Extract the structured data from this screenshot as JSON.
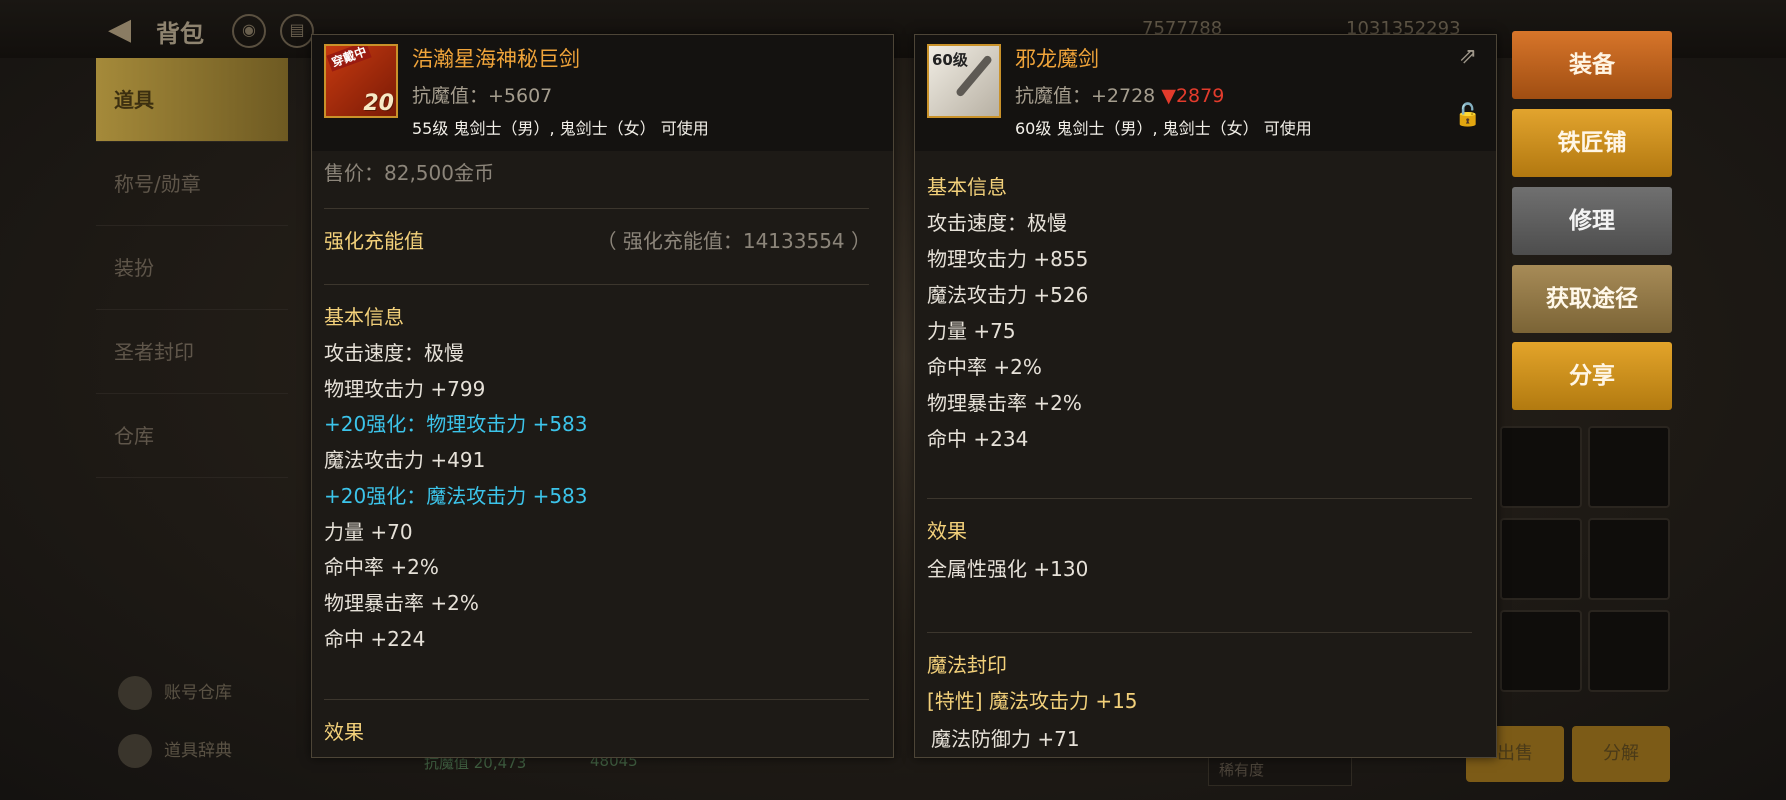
{
  "background": {
    "title": "背包",
    "currency_1": "7577788",
    "currency_2": "1031352293",
    "menu": [
      "道具",
      "称号/勋章",
      "装扮",
      "圣者封印",
      "仓库"
    ],
    "menu_bottom": [
      "账号仓库",
      "道具辞典"
    ],
    "bottom_buttons": [
      "出售",
      "分解"
    ],
    "sort_label": "稀有度",
    "stat_left": "抗魔值 20,473",
    "stat_right": "48045"
  },
  "left_item": {
    "thumb_badge": "穿戴中",
    "thumb_level": "20",
    "name": "浩瀚星海神秘巨剑",
    "resist": "抗魔值：+5607",
    "usable": "55级 鬼剑士（男）, 鬼剑士（女） 可使用",
    "price": "售价：82,500金币",
    "charge_label": "强化充能值",
    "charge_value": "（ 强化充能值：14133554 ）",
    "basic_info_title": "基本信息",
    "attack_speed": "攻击速度：极慢",
    "phys_attack": "物理攻击力 +799",
    "phys_reinforce": "+20强化：物理攻击力 +583",
    "magic_attack": "魔法攻击力 +491",
    "magic_reinforce": "+20强化：魔法攻击力 +583",
    "strength": "力量 +70",
    "hit_rate": "命中率 +2%",
    "phys_crit": "物理暴击率 +2%",
    "hit": "命中 +224",
    "effect_title": "效果"
  },
  "right_item": {
    "thumb_level": "60级",
    "name": "邪龙魔剑",
    "resist_label": "抗魔值：+2728",
    "resist_diff": "▼2879",
    "usable": "60级 鬼剑士（男）, 鬼剑士（女） 可使用",
    "basic_info_title": "基本信息",
    "attack_speed": "攻击速度：极慢",
    "phys_attack": "物理攻击力 +855",
    "magic_attack": "魔法攻击力 +526",
    "strength": "力量 +75",
    "hit_rate": "命中率 +2%",
    "phys_crit": "物理暴击率 +2%",
    "hit": "命中 +234",
    "effect_title": "效果",
    "effect_value": "全属性强化 +130",
    "seal_title": "魔法封印",
    "seal_trait": "[特性] 魔法攻击力 +15",
    "seal_defense": "魔法防御力 +71"
  },
  "actions": {
    "equip": "装备",
    "smith": "铁匠铺",
    "repair": "修理",
    "source": "获取途径",
    "share": "分享"
  },
  "colors": {
    "name": "#f0a43a",
    "reinforce": "#3cc4ea",
    "section_title": "#f2d07a",
    "decrease": "#e33b2c"
  }
}
